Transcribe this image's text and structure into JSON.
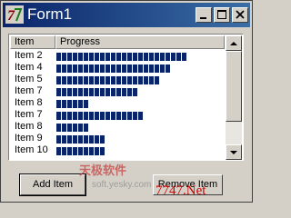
{
  "window": {
    "title": "Form1"
  },
  "titlebar_buttons": {
    "minimize": "minimize",
    "maximize": "maximize",
    "close": "close"
  },
  "listview": {
    "columns": [
      "Item",
      "Progress"
    ],
    "rows": [
      {
        "label": "Item 2",
        "progress_blocks": 24
      },
      {
        "label": "Item 4",
        "progress_blocks": 21
      },
      {
        "label": "Item 5",
        "progress_blocks": 19
      },
      {
        "label": "Item 7",
        "progress_blocks": 15
      },
      {
        "label": "Item 8",
        "progress_blocks": 6
      },
      {
        "label": "Item 7",
        "progress_blocks": 16
      },
      {
        "label": "Item 8",
        "progress_blocks": 6
      },
      {
        "label": "Item 9",
        "progress_blocks": 9
      },
      {
        "label": "Item 10",
        "progress_blocks": 9
      }
    ],
    "progress_color": "#0a246a"
  },
  "buttons": {
    "add_label": "Add Item",
    "remove_label": "Remove Item"
  },
  "watermark": {
    "chinese": "天极软件",
    "url": "soft.yesky.com",
    "site": "7747.Net"
  }
}
